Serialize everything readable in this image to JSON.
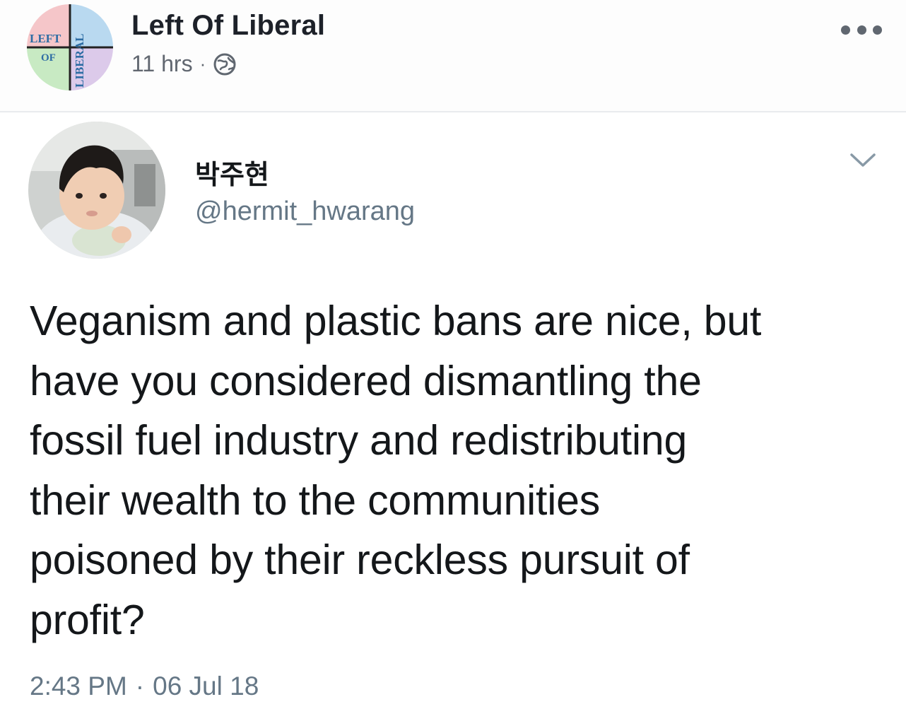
{
  "post": {
    "page_name": "Left Of Liberal",
    "time_ago": "11 hrs",
    "meta_separator": "·",
    "privacy_icon": "globe-icon",
    "more_icon": "more-options-icon"
  },
  "logo": {
    "text_left": "LEFT",
    "text_of": "OF",
    "text_liberal": "LIBERAL",
    "colors": {
      "top_left": "#f5c6c9",
      "top_right": "#b9d9f0",
      "bottom_left": "#c8eac3",
      "bottom_right": "#dccaea",
      "text": "#2e6da4",
      "axis": "#222222"
    }
  },
  "tweet": {
    "display_name": "박주현",
    "handle": "@hermit_hwarang",
    "text_lines": [
      "Veganism and plastic bans are nice, but",
      "have you considered dismantling the",
      "fossil fuel industry and redistributing",
      "their wealth to the communities",
      "poisoned by their reckless pursuit of",
      "profit?"
    ],
    "time": "2:43 PM",
    "date_separator": "·",
    "date": "06 Jul 18",
    "chevron_icon": "chevron-down-icon"
  },
  "colors": {
    "name": "#1d2129",
    "meta": "#616770",
    "tweet_text": "#14171a",
    "tweet_secondary": "#657786",
    "divider": "#e9ebee"
  }
}
